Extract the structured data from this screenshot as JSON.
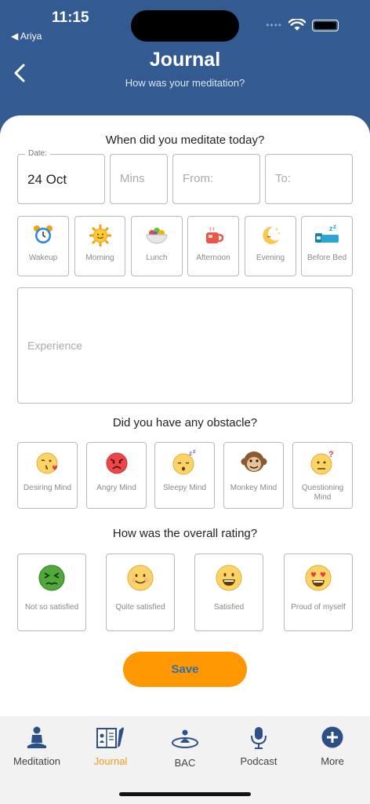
{
  "status": {
    "time": "11:15",
    "back_app": "◀ Ariya",
    "signal_dots": "••••"
  },
  "header": {
    "title": "Journal",
    "subtitle": "How was your meditation?"
  },
  "date_section": {
    "title": "When did you meditate today?",
    "date_legend": "Date:",
    "date_value": "24 Oct",
    "mins_placeholder": "Mins",
    "from_placeholder": "From:",
    "to_placeholder": "To:"
  },
  "times": [
    {
      "label": "Wakeup",
      "icon": "alarm-clock-icon"
    },
    {
      "label": "Morning",
      "icon": "sun-icon"
    },
    {
      "label": "Lunch",
      "icon": "salad-bowl-icon"
    },
    {
      "label": "Afternoon",
      "icon": "tea-cup-icon"
    },
    {
      "label": "Evening",
      "icon": "moon-icon"
    },
    {
      "label": "Before Bed",
      "icon": "bed-icon"
    }
  ],
  "experience": {
    "placeholder": "Experience"
  },
  "obstacle_section": {
    "title": "Did you have any obstacle?",
    "items": [
      {
        "label": "Desiring Mind",
        "icon": "kiss-face-icon"
      },
      {
        "label": "Angry Mind",
        "icon": "angry-face-icon"
      },
      {
        "label": "Sleepy Mind",
        "icon": "sleepy-face-icon"
      },
      {
        "label": "Monkey Mind",
        "icon": "monkey-face-icon"
      },
      {
        "label": "Questioning Mind",
        "icon": "questioning-face-icon"
      }
    ]
  },
  "rating_section": {
    "title": "How was the overall rating?",
    "items": [
      {
        "label": "Not so satisfied",
        "icon": "sick-face-icon"
      },
      {
        "label": "Quite satisfied",
        "icon": "smile-face-icon"
      },
      {
        "label": "Satisfied",
        "icon": "grin-face-icon"
      },
      {
        "label": "Proud of myself",
        "icon": "heart-eyes-face-icon"
      }
    ]
  },
  "save_label": "Save",
  "tabs": [
    {
      "label": "Meditation",
      "icon": "meditation-icon",
      "active": false
    },
    {
      "label": "Journal",
      "icon": "journal-icon",
      "active": true
    },
    {
      "label": "BAC",
      "icon": "bac-icon",
      "active": false
    },
    {
      "label": "Podcast",
      "icon": "microphone-icon",
      "active": false
    },
    {
      "label": "More",
      "icon": "plus-circle-icon",
      "active": false
    }
  ],
  "colors": {
    "header": "#345a92",
    "accent": "#ff9800",
    "active_tab": "#f39a16",
    "save_text": "#2e6fb4"
  }
}
